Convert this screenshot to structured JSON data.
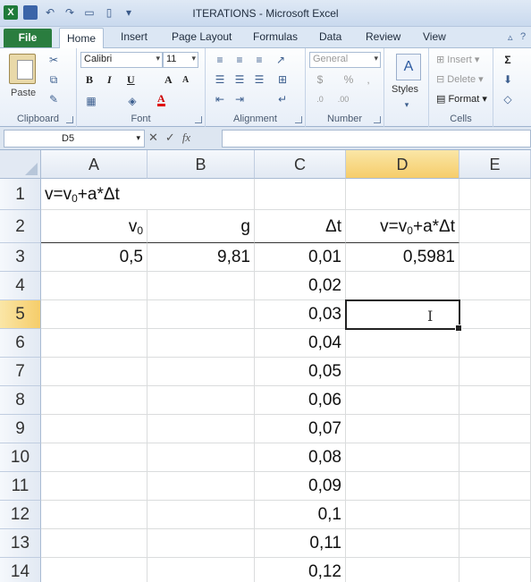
{
  "window": {
    "title": "ITERATIONS  -  Microsoft Excel"
  },
  "tabs": [
    "File",
    "Home",
    "Insert",
    "Page Layout",
    "Formulas",
    "Data",
    "Review",
    "View"
  ],
  "ribbon": {
    "clipboard": {
      "label": "Clipboard",
      "paste": "Paste"
    },
    "font": {
      "label": "Font",
      "name": "Calibri",
      "size": "11"
    },
    "alignment": {
      "label": "Alignment"
    },
    "number": {
      "label": "Number",
      "format": "General"
    },
    "styles": {
      "label": "Styles"
    },
    "cells": {
      "label": "Cells",
      "insert": "Insert",
      "delete": "Delete",
      "format": "Format"
    }
  },
  "formula_bar": {
    "name_box": "D5",
    "fx": "fx",
    "content": ""
  },
  "grid": {
    "columns": [
      "A",
      "B",
      "C",
      "D",
      "E"
    ],
    "rows": [
      "1",
      "2",
      "3",
      "4",
      "5",
      "6",
      "7",
      "8",
      "9",
      "10",
      "11",
      "12",
      "13",
      "14"
    ],
    "selected_col": "D",
    "selected_row": "5",
    "cells": {
      "A1_pre": "v=v",
      "A1_sub": "0",
      "A1_post": "+a*Δt",
      "A2_pre": "v",
      "A2_sub": "0",
      "B2": "g",
      "C2": "Δt",
      "D2_pre": "v=v",
      "D2_sub": "0",
      "D2_post": "+a*Δt",
      "A3": "0,5",
      "B3": "9,81",
      "C3": "0,01",
      "D3": "0,5981",
      "C4": "0,02",
      "C5": "0,03",
      "C6": "0,04",
      "C7": "0,05",
      "C8": "0,06",
      "C9": "0,07",
      "C10": "0,08",
      "C11": "0,09",
      "C12": "0,1",
      "C13": "0,11",
      "C14": "0,12"
    }
  }
}
